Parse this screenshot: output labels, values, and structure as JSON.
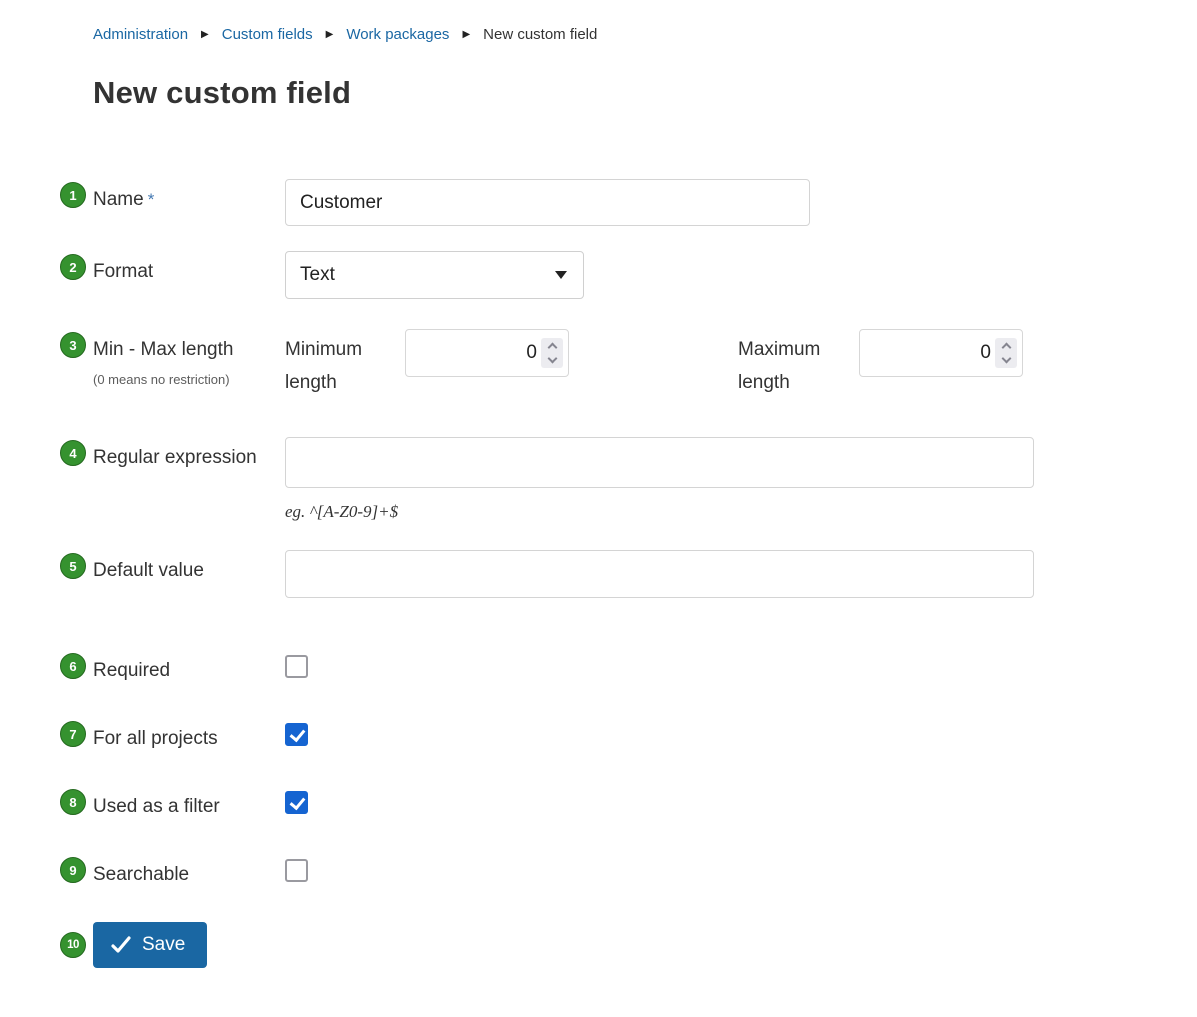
{
  "breadcrumb": {
    "separator": "▶",
    "items": [
      {
        "label": "Administration"
      },
      {
        "label": "Custom fields"
      },
      {
        "label": "Work packages"
      },
      {
        "label": "New custom field"
      }
    ]
  },
  "page": {
    "title": "New custom field"
  },
  "form": {
    "name": {
      "step": "1",
      "label": "Name",
      "required_marker": "*",
      "value": "Customer"
    },
    "format": {
      "step": "2",
      "label": "Format",
      "selected_option": "Text"
    },
    "length": {
      "step": "3",
      "label": "Min - Max length",
      "hint": "(0 means no restriction)",
      "min_label": "Minimum length",
      "min_value": "0",
      "max_label": "Maximum length",
      "max_value": "0"
    },
    "regex": {
      "step": "4",
      "label": "Regular expression",
      "value": "",
      "hint": "eg. ^[A-Z0-9]+$"
    },
    "default_value": {
      "step": "5",
      "label": "Default value",
      "value": ""
    },
    "required": {
      "step": "6",
      "label": "Required",
      "checked": false
    },
    "for_all_projects": {
      "step": "7",
      "label": "For all projects",
      "checked": true
    },
    "used_as_filter": {
      "step": "8",
      "label": "Used as a filter",
      "checked": true
    },
    "searchable": {
      "step": "9",
      "label": "Searchable",
      "checked": false
    },
    "save": {
      "step": "10",
      "label": "Save"
    }
  },
  "colors": {
    "link_blue": "#1A67A3",
    "save_button_blue": "#1A67A3",
    "checkbox_checked_blue": "#1564D1",
    "step_badge_green": "#35922F",
    "title_text": "#333333"
  }
}
